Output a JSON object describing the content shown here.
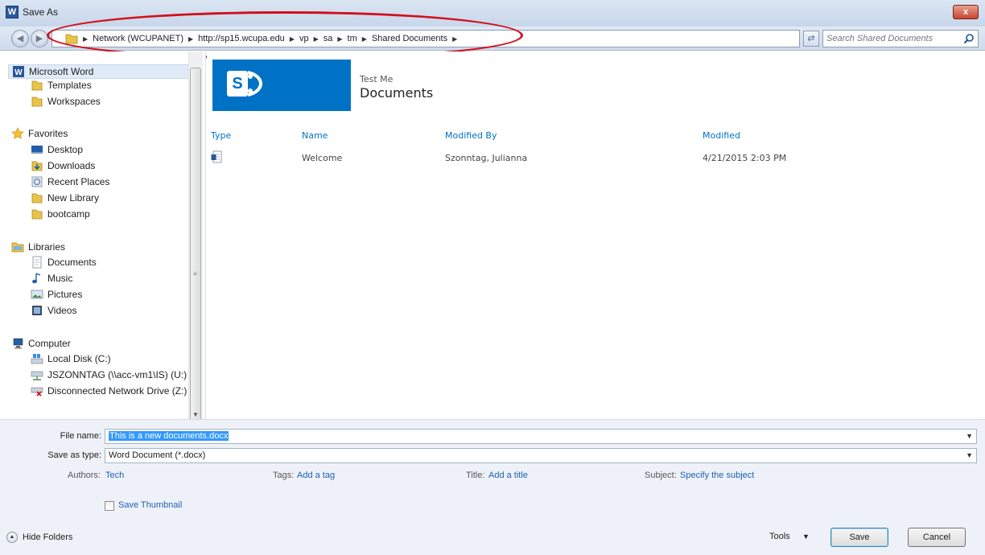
{
  "window": {
    "app_icon_letter": "W",
    "title": "Save As",
    "close_label": "x"
  },
  "address_bar": {
    "breadcrumbs": [
      "Network (WCUPANET)",
      "http://sp15.wcupa.edu",
      "vp",
      "sa",
      "tm",
      "Shared Documents"
    ],
    "search_placeholder": "Search Shared Documents"
  },
  "sidebar": {
    "items": [
      {
        "label": "Microsoft Word",
        "icon": "word-icon"
      },
      {
        "label": "Templates",
        "icon": "folder-icon"
      },
      {
        "label": "Workspaces",
        "icon": "folder-icon"
      },
      {
        "label": "Favorites",
        "icon": "star-icon"
      },
      {
        "label": "Desktop",
        "icon": "desktop-icon"
      },
      {
        "label": "Downloads",
        "icon": "downloads-icon"
      },
      {
        "label": "Recent Places",
        "icon": "recent-places-icon"
      },
      {
        "label": "New Library",
        "icon": "folder-icon"
      },
      {
        "label": "bootcamp",
        "icon": "folder-icon"
      },
      {
        "label": "Libraries",
        "icon": "libraries-icon"
      },
      {
        "label": "Documents",
        "icon": "documents-icon"
      },
      {
        "label": "Music",
        "icon": "music-icon"
      },
      {
        "label": "Pictures",
        "icon": "pictures-icon"
      },
      {
        "label": "Videos",
        "icon": "videos-icon"
      },
      {
        "label": "Computer",
        "icon": "computer-icon"
      },
      {
        "label": "Local Disk (C:)",
        "icon": "local-disk-icon"
      },
      {
        "label": "JSZONNTAG (\\\\acc-vm1\\IS) (U:)",
        "icon": "network-drive-icon"
      },
      {
        "label": "Disconnected Network Drive (Z:)",
        "icon": "disconnected-drive-icon"
      }
    ]
  },
  "site": {
    "logo_letter": "S",
    "subtitle": "Test Me",
    "title": "Documents"
  },
  "table": {
    "columns": [
      "Type",
      "Name",
      "Modified By",
      "Modified"
    ],
    "rows": [
      {
        "type_icon": "word-doc-icon",
        "name": "Welcome",
        "modified_by": "Szonntag, Julianna",
        "modified": "4/21/2015 2:03 PM"
      }
    ]
  },
  "form": {
    "file_name_label": "File name:",
    "file_name_value": "This is a new documents.docx",
    "save_type_label": "Save as type:",
    "save_type_value": "Word Document (*.docx)",
    "authors_label": "Authors:",
    "authors_value": "Tech",
    "tags_label": "Tags:",
    "tags_value": "Add a tag",
    "title_label": "Title:",
    "title_value": "Add a title",
    "subject_label": "Subject:",
    "subject_value": "Specify the subject",
    "save_thumbnail_label": "Save Thumbnail",
    "save_thumbnail_checked": false
  },
  "footer": {
    "hide_folders_label": "Hide Folders",
    "tools_label": "Tools",
    "save_label": "Save",
    "cancel_label": "Cancel"
  },
  "colors": {
    "sharepoint_blue": "#0072c6",
    "annotation_red": "#d10f1b",
    "link_blue": "#1e5fb5"
  }
}
